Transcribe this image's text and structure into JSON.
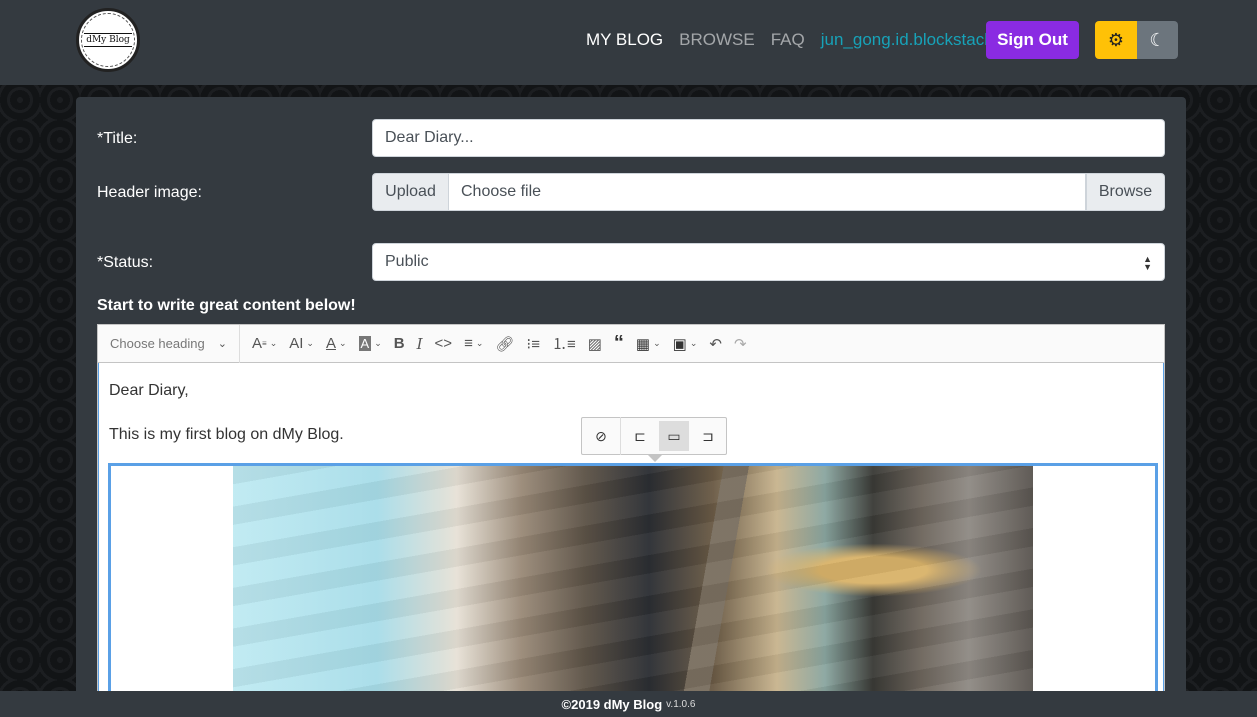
{
  "navbar": {
    "logo_text": "dMy Blog",
    "links": [
      {
        "label": "MY BLOG",
        "active": true
      },
      {
        "label": "BROWSE",
        "active": false
      },
      {
        "label": "FAQ",
        "active": false
      }
    ],
    "user": "jun_gong.id.blockstack",
    "signout_label": "Sign Out",
    "icons": {
      "user": "gear-icon",
      "light": "sun-gear-icon",
      "dark": "moon-icon"
    },
    "colors": {
      "signout": "#8a2be2",
      "user": "#17a2b8",
      "light": "#ffc107",
      "dark": "#6c757d"
    }
  },
  "form": {
    "title_label": "*Title:",
    "title_value": "Dear Diary...",
    "header_label": "Header image:",
    "upload_label": "Upload",
    "file_placeholder": "Choose file",
    "browse_label": "Browse",
    "status_label": "*Status:",
    "status_value": "Public",
    "content_label": "Start to write great content below!"
  },
  "editor": {
    "heading_placeholder": "Choose heading",
    "paragraphs": [
      "Dear Diary,",
      "This is my first blog on dMy Blog."
    ],
    "toolbar_icons": [
      "font-size-icon",
      "font-family-icon",
      "font-color-icon",
      "font-background-icon",
      "bold-icon",
      "italic-icon",
      "code-icon",
      "alignment-icon",
      "link-icon",
      "bulleted-list-icon",
      "numbered-list-icon",
      "image-icon",
      "blockquote-icon",
      "table-icon",
      "media-icon",
      "undo-icon",
      "redo-icon"
    ],
    "image_toolbar_icons": [
      "hide-alt-icon",
      "align-left-icon",
      "full-width-icon",
      "align-right-icon"
    ]
  },
  "footer": {
    "copyright": "©2019 dMy Blog",
    "version": "v.1.0.6"
  }
}
